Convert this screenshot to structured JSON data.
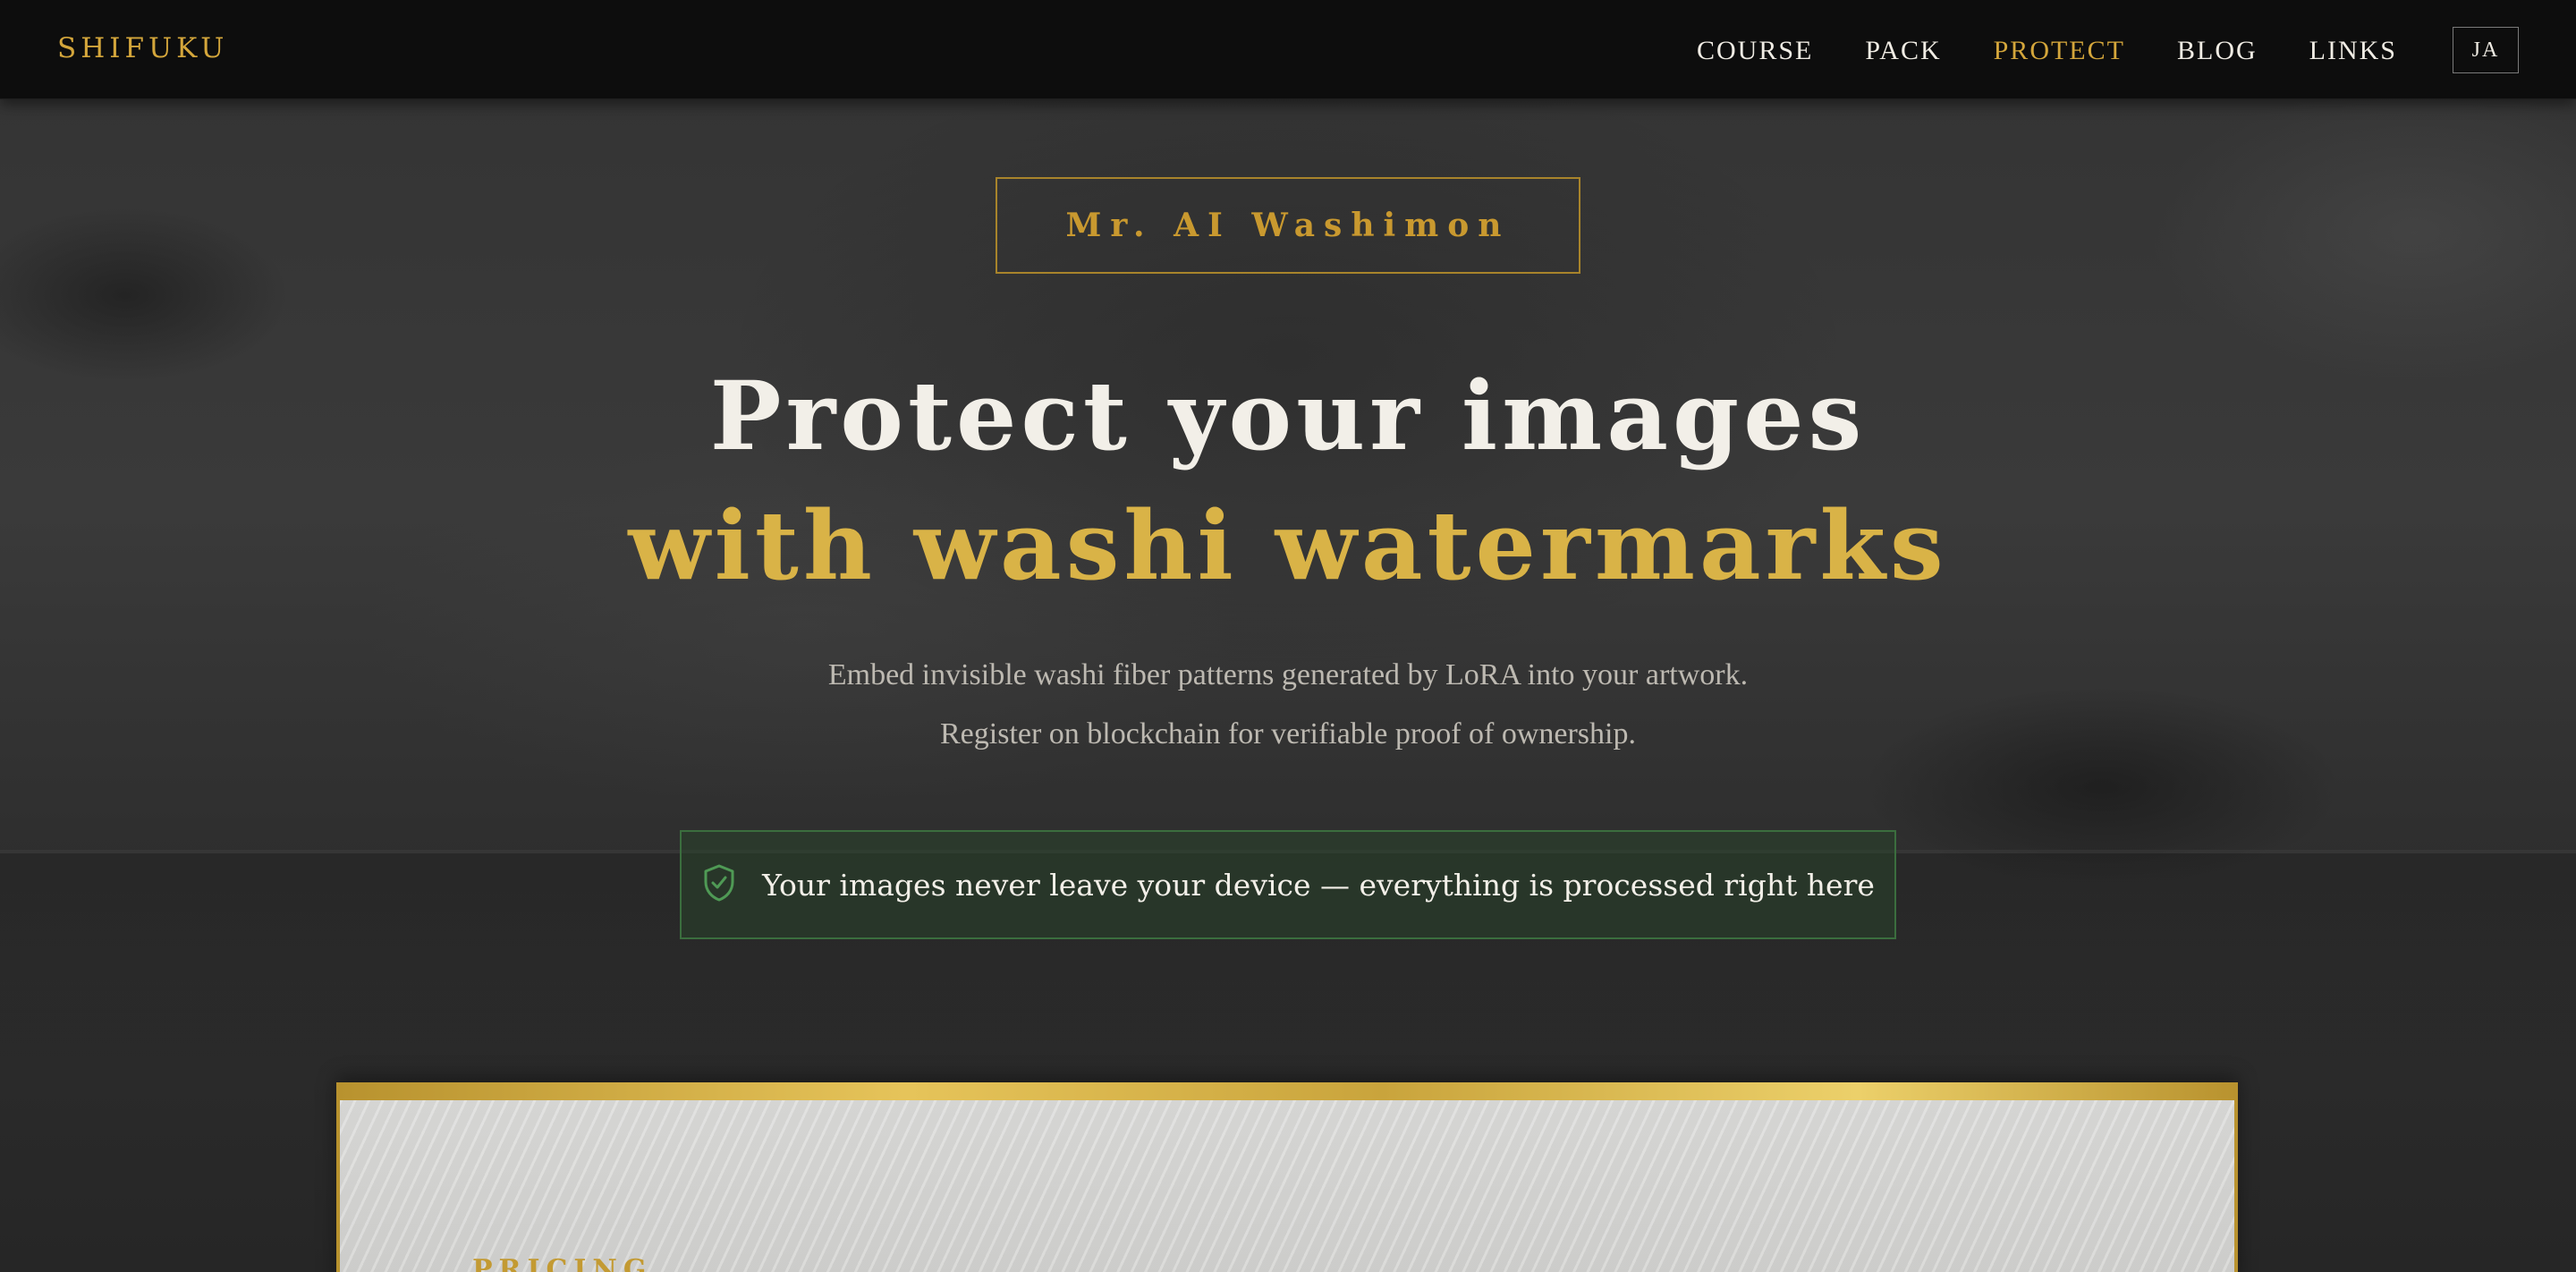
{
  "header": {
    "logo": "SHIFUKU",
    "nav": [
      {
        "label": "COURSE",
        "active": false
      },
      {
        "label": "PACK",
        "active": false
      },
      {
        "label": "PROTECT",
        "active": true
      },
      {
        "label": "BLOG",
        "active": false
      },
      {
        "label": "LINKS",
        "active": false
      }
    ],
    "lang_button": "JA"
  },
  "hero": {
    "badge": "Mr. AI Washimon",
    "title_line1": "Protect your images",
    "title_line2": "with washi watermarks",
    "subtitle_line1": "Embed invisible washi fiber patterns generated by LoRA into your artwork.",
    "subtitle_line2": "Register on blockchain for verifiable proof of ownership.",
    "privacy_notice": "Your images never leave your device — everything is processed right here",
    "privacy_icon": "shield-check-icon"
  },
  "pricing": {
    "section_label": "PRICING"
  },
  "colors": {
    "accent_gold": "#d4a63b",
    "title_gold": "#d9b347",
    "privacy_green": "#3b6e3e",
    "header_bg": "#0d0d0d"
  }
}
